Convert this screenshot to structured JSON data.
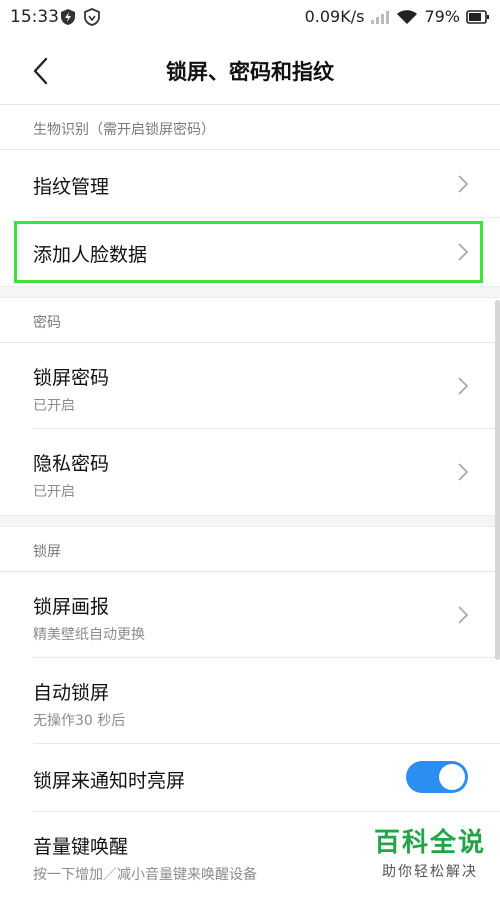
{
  "status_bar": {
    "time": "15:33",
    "network_speed": "0.09K/s",
    "battery": "79%"
  },
  "header": {
    "title": "锁屏、密码和指纹"
  },
  "sections": {
    "biometrics": {
      "header": "生物识别（需开启锁屏密码）",
      "items": [
        {
          "label": "指纹管理"
        },
        {
          "label": "添加人脸数据"
        }
      ]
    },
    "password": {
      "header": "密码",
      "items": [
        {
          "label": "锁屏密码",
          "sub": "已开启"
        },
        {
          "label": "隐私密码",
          "sub": "已开启"
        }
      ]
    },
    "lockscreen": {
      "header": "锁屏",
      "items": [
        {
          "label": "锁屏画报",
          "sub": "精美壁纸自动更换"
        },
        {
          "label": "自动锁屏",
          "sub": "无操作30 秒后"
        },
        {
          "label": "锁屏来通知时亮屏",
          "toggle_on": true
        },
        {
          "label": "音量键唤醒",
          "sub": "按一下增加／减小音量键来唤醒设备"
        }
      ]
    }
  },
  "watermark": {
    "main": "百科全说",
    "sub": "助你轻松解决"
  },
  "colors": {
    "accent": "#2a8ff0",
    "highlight": "#3fe23a",
    "watermark": "#22a447"
  }
}
